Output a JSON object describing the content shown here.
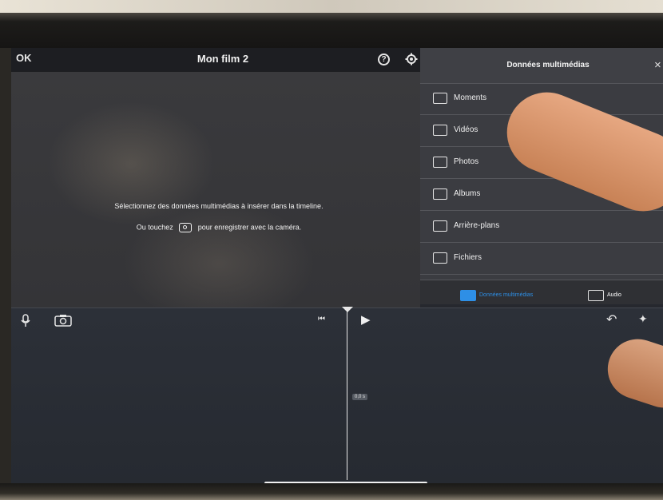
{
  "header": {
    "ok_label": "OK",
    "title": "Mon film 2",
    "help_label": "?"
  },
  "viewer": {
    "message_line1": "Sélectionnez des données multimédias à insérer dans la timeline.",
    "message_line2_before": "Ou touchez",
    "message_line2_after": "pour enregistrer avec la caméra."
  },
  "media_panel": {
    "title": "Données multimédias",
    "close": "×",
    "items": [
      {
        "label": "Moments",
        "icon": "moments-icon"
      },
      {
        "label": "Vidéos",
        "icon": "film-icon"
      },
      {
        "label": "Photos",
        "icon": "photo-icon"
      },
      {
        "label": "Albums",
        "icon": "album-icon"
      },
      {
        "label": "Arrière-plans",
        "icon": "background-icon"
      },
      {
        "label": "Fichiers",
        "icon": "folder-icon"
      }
    ],
    "tabs": {
      "media": "Données multimédias",
      "audio": "Audio"
    }
  },
  "timeline": {
    "time": "0,0 s",
    "skip_back": "⏮",
    "play": "▶",
    "undo": "↶",
    "audio_wave": "✦"
  },
  "colors": {
    "accent": "#2e8fe6",
    "panel_bg": "#3b3c41",
    "timeline_bg": "#2a2e35"
  }
}
